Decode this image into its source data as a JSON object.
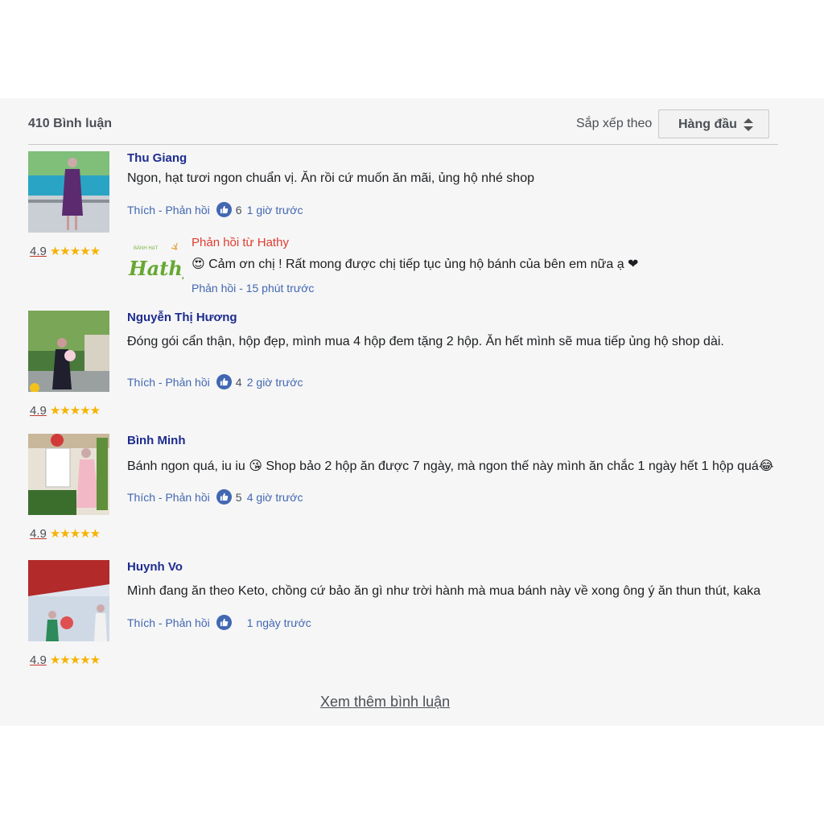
{
  "header": {
    "count_label": "410 Bình luận",
    "sort_label": "Sắp xếp theo",
    "sort_value": "Hàng đầu"
  },
  "comments": [
    {
      "name": "Thu Giang",
      "text": "Ngon, hạt tươi ngon chuẩn vị. Ăn rồi cứ muốn ăn mãi, ủng hộ nhé shop",
      "actions": "Thích - Phản hồi",
      "likes": "6",
      "time": "1 giờ trước",
      "rating": "4.9",
      "stars": "★★★★★"
    },
    {
      "name": "Nguyễn Thị Hương",
      "text": "Đóng gói cẩn thận, hộp đẹp, mình mua 4 hộp đem tặng 2 hộp. Ăn hết mình sẽ mua tiếp ủng hộ shop dài.",
      "actions": "Thích - Phản hồi",
      "likes": "4",
      "time": "2 giờ trước",
      "rating": "4.9",
      "stars": "★★★★★"
    },
    {
      "name": "Bình Minh",
      "text": "Bánh ngon quá, iu iu 😘 Shop bảo 2 hộp ăn được 7 ngày, mà ngon thế này mình ăn chắc 1 ngày hết 1 hộp quá😂",
      "actions": "Thích - Phản hồi",
      "likes": "5",
      "time": "4 giờ trước",
      "rating": "4.9",
      "stars": "★★★★★"
    },
    {
      "name": "Huynh Vo",
      "text": "Mình đang ăn theo Keto, chồng cứ bảo ăn gì như trời hành mà mua bánh này về xong ông ý ăn thun thút, kaka",
      "actions": "Thích - Phản hồi",
      "likes": "",
      "time": "1 ngày trước",
      "rating": "4.9",
      "stars": "★★★★★"
    }
  ],
  "reply": {
    "from": "Phản hồi từ Hathy",
    "text": "😍 Cảm ơn chị ! Rất mong được chị tiếp tục ủng hộ bánh của bên em nữa ạ ❤",
    "meta": "Phản hồi - 15 phút trước",
    "logo_top": "BÁNH HẠT",
    "logo_word": "Hathy"
  },
  "load_more": "Xem thêm bình luận",
  "colors": {
    "name": "#1d2c8f",
    "link": "#4267b2",
    "star": "#f5b301",
    "reply_name": "#e03c31",
    "panel_bg": "#f6f6f6"
  }
}
